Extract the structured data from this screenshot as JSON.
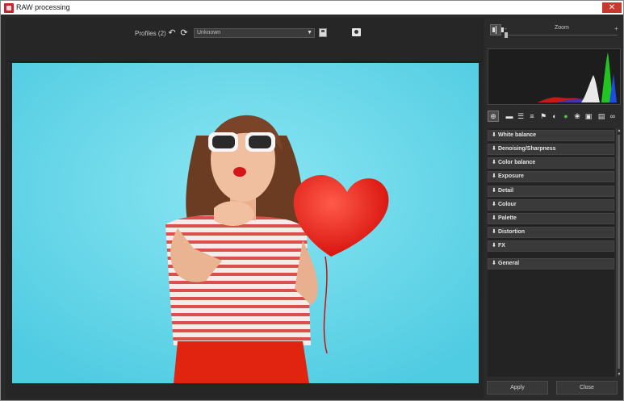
{
  "window": {
    "title": "RAW processing",
    "close_glyph": "✕"
  },
  "toolbar": {
    "profiles_label": "Profiles (2)",
    "undo_icon": "undo-icon",
    "redo_icon": "redo-icon",
    "profile_value": "Unknown",
    "save_icon": "save-icon",
    "snapshot_icon": "camera-icon"
  },
  "zoom": {
    "label": "Zoom",
    "minus": "-",
    "plus": "+"
  },
  "colors": {
    "panel_bg": "#2b2b2b",
    "section_bg": "#3a3a3a",
    "photo_bg": "#5fd4e8",
    "histogram_red": "#d42020",
    "histogram_green": "#22c422",
    "histogram_white": "#e8e8e8"
  },
  "tool_icons": [
    "target-icon",
    "ruler-icon",
    "levels-icon",
    "curves-icon",
    "flag-icon",
    "contrast-icon",
    "circle-icon",
    "palette-icon",
    "camera-raw-icon",
    "frame-icon",
    "glasses-icon"
  ],
  "sections": [
    {
      "label": "White balance"
    },
    {
      "label": "Denoising/Sharpness"
    },
    {
      "label": "Color balance"
    },
    {
      "label": "Exposure"
    },
    {
      "label": "Detail"
    },
    {
      "label": "Colour"
    },
    {
      "label": "Palette"
    },
    {
      "label": "Distortion"
    },
    {
      "label": "FX"
    },
    {
      "label": "General"
    }
  ],
  "buttons": {
    "apply": "Apply",
    "close": "Close"
  }
}
